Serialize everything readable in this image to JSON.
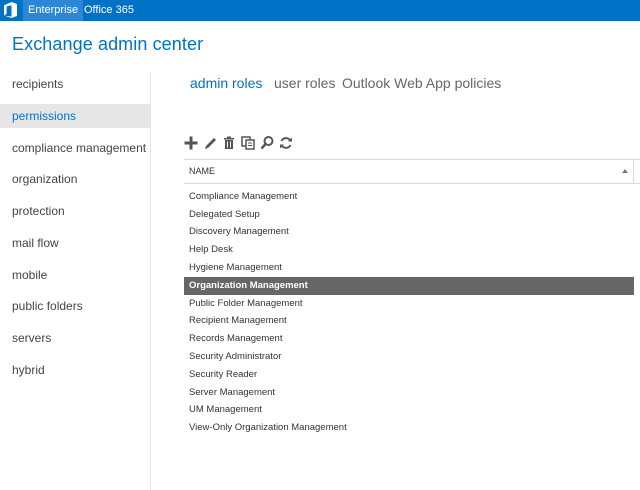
{
  "topbar": {
    "logo_icon": "office-logo-icon",
    "enterprise_label": "Enterprise",
    "office365_label": "Office 365",
    "accent_color": "#0072c6"
  },
  "app": {
    "title": "Exchange admin center"
  },
  "sidebar": {
    "selected": "permissions",
    "items": [
      "recipients",
      "permissions",
      "compliance management",
      "organization",
      "protection",
      "mail flow",
      "mobile",
      "public folders",
      "servers",
      "hybrid"
    ]
  },
  "tabs": {
    "active": "admin roles",
    "items": [
      "admin roles",
      "user roles",
      "Outlook Web App policies"
    ]
  },
  "toolbar": {
    "icons": [
      "add-icon",
      "edit-icon",
      "delete-icon",
      "copy-icon",
      "search-icon",
      "refresh-icon"
    ]
  },
  "grid": {
    "column_header": "NAME",
    "sort_direction": "ascending",
    "selected_row": "Organization Management",
    "rows": [
      "Compliance Management",
      "Delegated Setup",
      "Discovery Management",
      "Help Desk",
      "Hygiene Management",
      "Organization Management",
      "Public Folder Management",
      "Recipient Management",
      "Records Management",
      "Security Administrator",
      "Security Reader",
      "Server Management",
      "UM Management",
      "View-Only Organization Management"
    ]
  }
}
